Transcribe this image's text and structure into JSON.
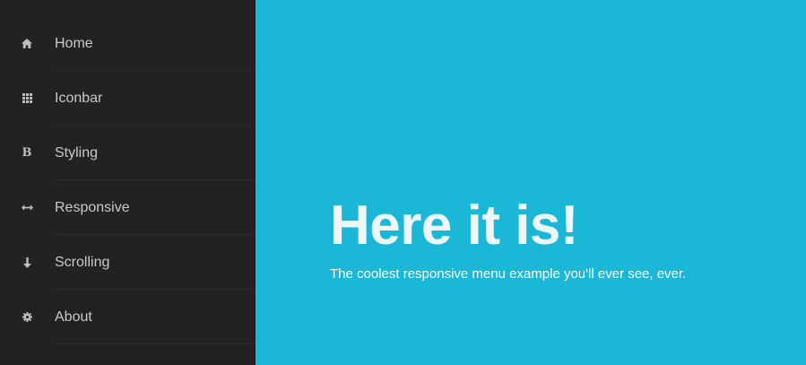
{
  "sidebar": {
    "items": [
      {
        "label": "Home",
        "icon": "home-icon"
      },
      {
        "label": "Iconbar",
        "icon": "grid-icon"
      },
      {
        "label": "Styling",
        "icon": "bold-icon"
      },
      {
        "label": "Responsive",
        "icon": "horizontal-resize-icon"
      },
      {
        "label": "Scrolling",
        "icon": "arrow-down-icon"
      },
      {
        "label": "About",
        "icon": "gear-icon"
      }
    ],
    "styling_icon_glyph": "B"
  },
  "hero": {
    "title": "Here it is!",
    "subtitle": "The coolest responsive menu example you'll ever see, ever."
  },
  "colors": {
    "sidebar_background": "#222222",
    "content_background": "#1bb7d6",
    "menu_text": "#c9c9c9",
    "hero_text": "#edf7fa"
  }
}
